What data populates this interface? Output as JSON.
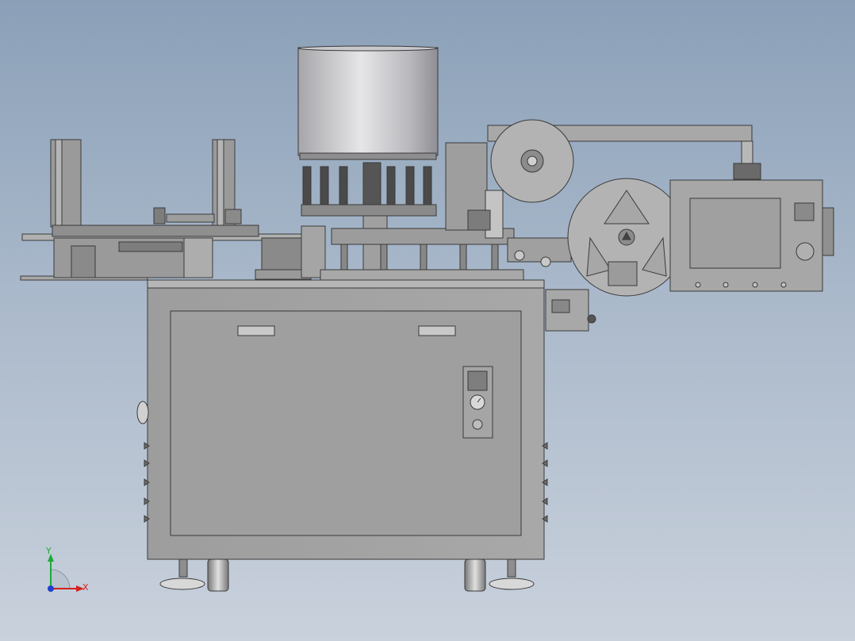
{
  "triad": {
    "y_label": "Y",
    "x_label": "X",
    "x_color": "#d42020",
    "y_color": "#1fa83a",
    "z_color": "#2040d0"
  },
  "colors": {
    "background_top": "#8ba0b8",
    "background_bottom": "#c9d1dc",
    "cabinet": "#a3a3a3",
    "hopper": "#bdbdc0",
    "frame": "#8c8c8c"
  },
  "icons": {
    "triad": "coordinate-triad-icon",
    "gauge": "pressure-gauge-icon",
    "reel": "label-reel-icon"
  }
}
